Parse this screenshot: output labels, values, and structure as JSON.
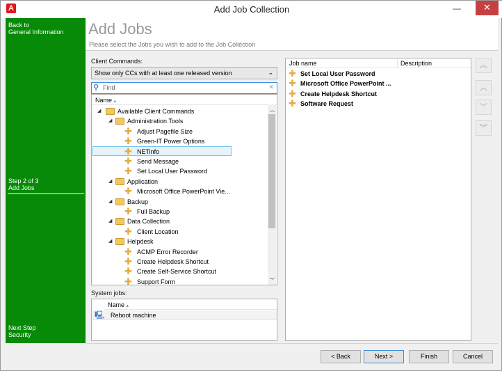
{
  "window": {
    "title": "Add Job Collection",
    "app_icon": "A",
    "minimize": "—",
    "close": "✕"
  },
  "sidebar": {
    "back_line1": "Back to",
    "back_line2": "General Information",
    "step_line1": "Step 2 of 3",
    "step_line2": "Add Jobs",
    "next_line1": "Next Step",
    "next_line2": "Security",
    "bg": "#078a07"
  },
  "header": {
    "title": "Add Jobs",
    "subtitle": "Please select the Jobs you wish to add to the Job Collection"
  },
  "client_commands": {
    "label": "Client Commands:",
    "filter": "Show only CCs with at least one released version",
    "find_placeholder": "Find",
    "column": "Name",
    "tree": [
      {
        "label": "Available Client Commands",
        "level": 0,
        "type": "folder"
      },
      {
        "label": "Administration Tools",
        "level": 1,
        "type": "folder"
      },
      {
        "label": "Adjust Pagefile Size",
        "level": 2,
        "type": "cc"
      },
      {
        "label": "Green-IT Power Options",
        "level": 2,
        "type": "cc"
      },
      {
        "label": "NETinfo",
        "level": 2,
        "type": "cc",
        "selected": true
      },
      {
        "label": "Send Message",
        "level": 2,
        "type": "cc"
      },
      {
        "label": "Set Local User Password",
        "level": 2,
        "type": "cc"
      },
      {
        "label": "Application",
        "level": 1,
        "type": "folder"
      },
      {
        "label": "Microsoft Office PowerPoint Vie...",
        "level": 2,
        "type": "cc"
      },
      {
        "label": "Backup",
        "level": 1,
        "type": "folder"
      },
      {
        "label": "Full Backup",
        "level": 2,
        "type": "cc"
      },
      {
        "label": "Data Collection",
        "level": 1,
        "type": "folder"
      },
      {
        "label": "Client Location",
        "level": 2,
        "type": "cc"
      },
      {
        "label": "Helpdesk",
        "level": 1,
        "type": "folder"
      },
      {
        "label": "ACMP Error Recorder",
        "level": 2,
        "type": "cc"
      },
      {
        "label": "Create Helpdesk Shortcut",
        "level": 2,
        "type": "cc"
      },
      {
        "label": "Create Self-Service Shortcut",
        "level": 2,
        "type": "cc"
      },
      {
        "label": "Support Form",
        "level": 2,
        "type": "cc"
      }
    ]
  },
  "system_jobs": {
    "label": "System jobs:",
    "column": "Name",
    "items": [
      "Reboot machine"
    ]
  },
  "jobs": {
    "col_name": "Job name",
    "col_desc": "Description",
    "items": [
      "Set Local User Password",
      "Microsoft Office PowerPoint ...",
      "Create Helpdesk Shortcut",
      "Software Request"
    ]
  },
  "move": {
    "top": "︽",
    "up": "︿",
    "down": "﹀",
    "bottom": "︾"
  },
  "footer": {
    "back": "< Back",
    "next": "Next >",
    "finish": "Finish",
    "cancel": "Cancel"
  }
}
